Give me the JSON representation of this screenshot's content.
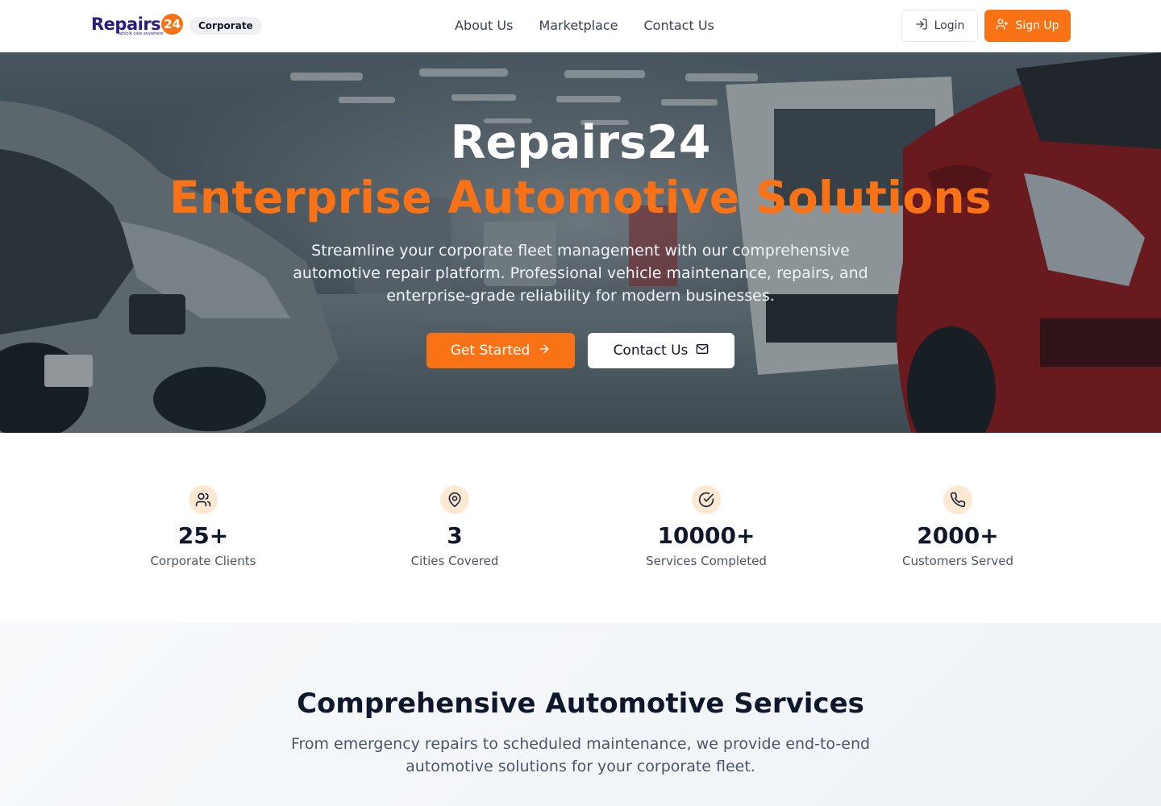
{
  "header": {
    "logo_text": "Repairs",
    "logo_number": "24",
    "logo_tagline": "vehicle care anywhere",
    "badge": "Corporate",
    "nav": [
      "About Us",
      "Marketplace",
      "Contact Us"
    ],
    "login_label": "Login",
    "signup_label": "Sign Up"
  },
  "hero": {
    "title": "Repairs24",
    "subtitle": "Enterprise Automotive Solutions",
    "description": "Streamline your corporate fleet management with our comprehensive automotive repair platform. Professional vehicle maintenance, repairs, and enterprise-grade reliability for modern businesses.",
    "primary_cta": "Get Started",
    "secondary_cta": "Contact Us"
  },
  "stats": [
    {
      "icon": "users-icon",
      "value": "25+",
      "label": "Corporate Clients"
    },
    {
      "icon": "map-pin-icon",
      "value": "3",
      "label": "Cities Covered"
    },
    {
      "icon": "check-circle-icon",
      "value": "10000+",
      "label": "Services Completed"
    },
    {
      "icon": "phone-icon",
      "value": "2000+",
      "label": "Customers Served"
    }
  ],
  "services": {
    "title": "Comprehensive Automotive Services",
    "description": "From emergency repairs to scheduled maintenance, we provide end-to-end automotive solutions for your corporate fleet."
  },
  "colors": {
    "accent": "#f97316",
    "brand": "#2b1b7e",
    "stat_icon_bg": "#fde8d3",
    "text_dark": "#0f172a"
  }
}
